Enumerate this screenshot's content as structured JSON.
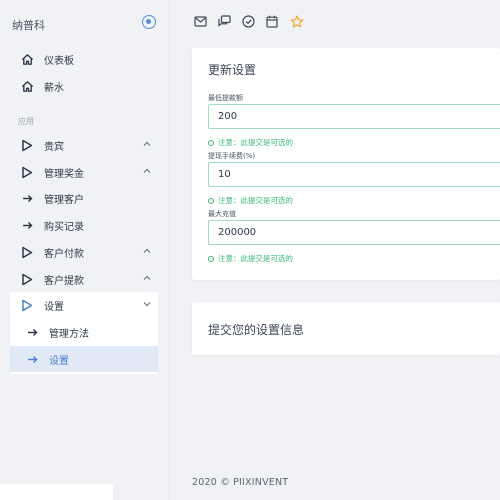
{
  "sidebar": {
    "brand": "纳普科",
    "section_label": "应用",
    "items": [
      {
        "label": "仪表板",
        "icon": "home-icon"
      },
      {
        "label": "薪水",
        "icon": "home-icon"
      },
      {
        "label": "贵宾",
        "icon": "play-icon"
      },
      {
        "label": "管理奖金",
        "icon": "play-icon"
      },
      {
        "label": "管理客户",
        "icon": "arrow-right-icon"
      },
      {
        "label": "购买记录",
        "icon": "arrow-right-icon"
      },
      {
        "label": "客户付款",
        "icon": "play-icon"
      },
      {
        "label": "客户提款",
        "icon": "play-icon"
      },
      {
        "label": "设置",
        "icon": "play-icon"
      },
      {
        "label": "管理方法",
        "icon": "arrow-right-icon"
      },
      {
        "label": "设置",
        "icon": "arrow-right-icon"
      }
    ]
  },
  "topbar": {
    "icons": [
      "mail-icon",
      "chat-icon",
      "check-circle-icon",
      "calendar-icon",
      "star-icon"
    ]
  },
  "settings_card": {
    "title": "更新设置",
    "fields": [
      {
        "label": "最低提款额",
        "value": "200",
        "hint": "注意：此提交是可选的"
      },
      {
        "label": "提现手续费(%)",
        "value": "10",
        "hint": "注意：此提交是可选的"
      },
      {
        "label": "最大充值",
        "value": "200000",
        "hint": "注意：此提交是可选的"
      }
    ]
  },
  "submit_card": {
    "title": "提交您的设置信息"
  },
  "footer": {
    "text": "2020 © PIIXINVENT"
  },
  "colors": {
    "accent": "#4f8fd8",
    "active_bg": "#e1e9f7",
    "hint_green": "#39b878",
    "star": "#f0a830"
  }
}
